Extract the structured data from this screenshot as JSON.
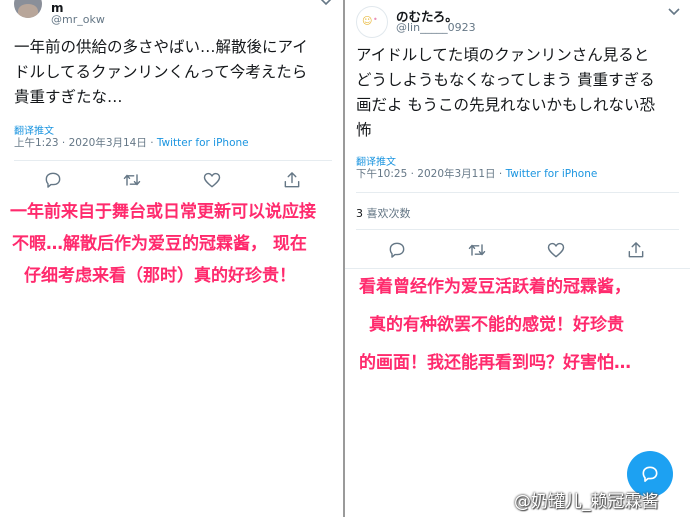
{
  "left_tweet": {
    "username": "m",
    "handle": "@mr_okw",
    "text_lines": [
      "一年前の供給の多さやばい…解散後にアイ",
      "ドルしてるクァンリンくんって今考えたら",
      "貴重すぎたな…"
    ],
    "translate_label": "翻译推文",
    "timestamp": "上午1:23 · 2020年3月14日 · ",
    "source": "Twitter for iPhone",
    "caption_lines": [
      "一年前来自于舞台或日常更新可以说应接",
      "不暇…解散后作为爱豆的冠霖酱， 现在",
      "仔细考虑来看（那时）真的好珍贵！"
    ]
  },
  "right_tweet": {
    "username": "のむたろ。",
    "handle": "@lin_____0923",
    "text_lines": [
      "アイドルしてた頃のクァンリンさん見ると",
      "どうしようもなくなってしまう 貴重すぎる",
      "画だよ もうこの先見れないかもしれない恐",
      "怖"
    ],
    "translate_label": "翻译推文",
    "timestamp": "下午10:25 · 2020年3月11日 · ",
    "source": "Twitter for iPhone",
    "likes_count": "3",
    "likes_label": " 喜欢次数",
    "caption_lines": [
      "看着曾经作为爱豆活跃着的冠霖酱，",
      "真的有种欲罢不能的感觉！好珍贵",
      "的画面！我还能再看到吗？好害怕…"
    ]
  },
  "watermark": "@奶罐儿_赖冠霖酱",
  "colors": {
    "accent": "#1da1f2",
    "link": "#1b95e0",
    "caption": "#ff2a6d",
    "secondary_text": "#657786"
  },
  "icons": [
    "reply-icon",
    "retweet-icon",
    "like-icon",
    "share-icon",
    "caret-down-icon",
    "compose-icon"
  ]
}
